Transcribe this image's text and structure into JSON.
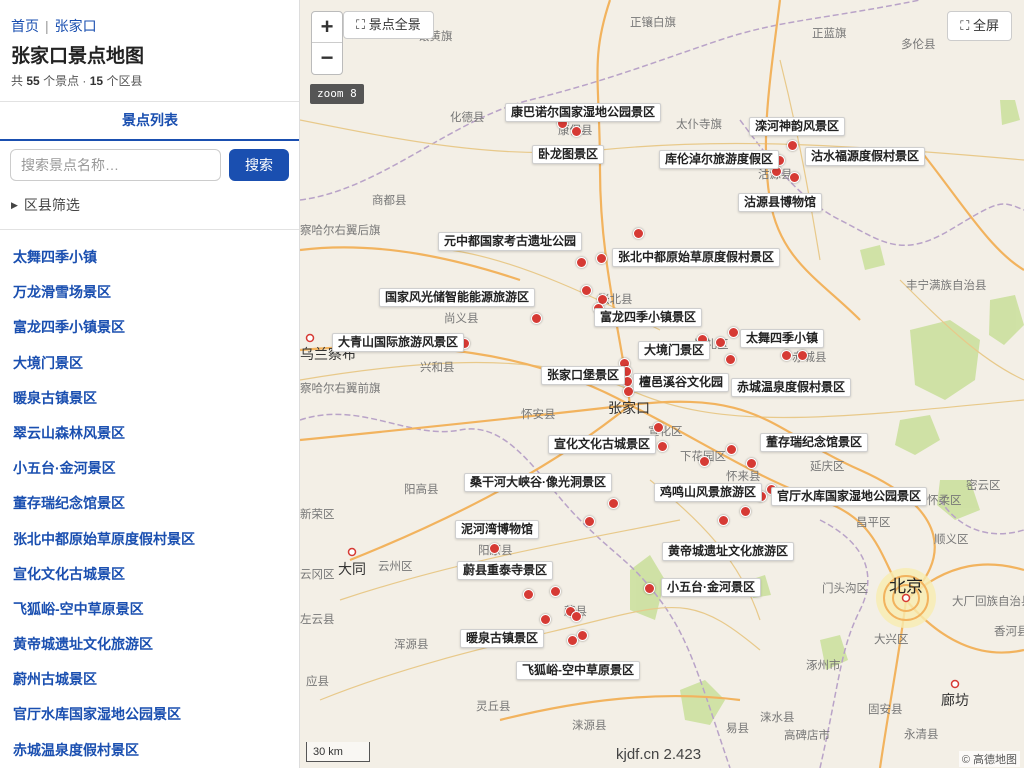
{
  "breadcrumb": {
    "home": "首页",
    "current": "张家口"
  },
  "title": "张家口景点地图",
  "stats": {
    "prefix": "共",
    "spots": "55",
    "spots_suffix": "个景点 ·",
    "counties": "15",
    "counties_suffix": "个区县"
  },
  "tab": "景点列表",
  "search": {
    "placeholder": "搜索景点名称…",
    "button": "搜索"
  },
  "filter": {
    "label": "区县筛选"
  },
  "spots": [
    "太舞四季小镇",
    "万龙滑雪场景区",
    "富龙四季小镇景区",
    "大境门景区",
    "暖泉古镇景区",
    "翠云山森林风景区",
    "小五台·金河景区",
    "董存瑞纪念馆景区",
    "张北中都原始草原度假村景区",
    "宣化文化古城景区",
    "飞狐峪-空中草原景区",
    "黄帝城遗址文化旅游区",
    "蔚州古城景区",
    "官厅水库国家湿地公园景区",
    "赤城温泉度假村景区"
  ],
  "map": {
    "zoom_in": "+",
    "zoom_out": "−",
    "overview": "景点全景",
    "fullscreen": "全屏",
    "zoom_level": "zoom 8",
    "scale": "30 km",
    "brand": "kjdf.cn 2.423",
    "attribution": "© 高德地图",
    "places": [
      {
        "name": "正镶白旗",
        "cls": ""
      },
      {
        "name": "镶黄旗",
        "cls": ""
      },
      {
        "name": "正蓝旗",
        "cls": ""
      },
      {
        "name": "多伦县",
        "cls": ""
      },
      {
        "name": "化德县",
        "cls": ""
      },
      {
        "name": "太仆寺旗",
        "cls": ""
      },
      {
        "name": "康保县",
        "cls": ""
      },
      {
        "name": "沽源县",
        "cls": ""
      },
      {
        "name": "商都县",
        "cls": ""
      },
      {
        "name": "察哈尔右翼后旗",
        "cls": ""
      },
      {
        "name": "张北县",
        "cls": ""
      },
      {
        "name": "丰宁满族自治县",
        "cls": ""
      },
      {
        "name": "尚义县",
        "cls": ""
      },
      {
        "name": "崇礼区",
        "cls": ""
      },
      {
        "name": "赤城县",
        "cls": ""
      },
      {
        "name": "乌兰察布",
        "cls": "city"
      },
      {
        "name": "兴和县",
        "cls": ""
      },
      {
        "name": "察哈尔右翼前旗",
        "cls": ""
      },
      {
        "name": "怀安县",
        "cls": ""
      },
      {
        "name": "张家口",
        "cls": "city"
      },
      {
        "name": "宣化区",
        "cls": ""
      },
      {
        "name": "下花园区",
        "cls": ""
      },
      {
        "name": "延庆区",
        "cls": ""
      },
      {
        "name": "怀来县",
        "cls": ""
      },
      {
        "name": "阳高县",
        "cls": ""
      },
      {
        "name": "新荣区",
        "cls": ""
      },
      {
        "name": "怀柔区",
        "cls": ""
      },
      {
        "name": "密云区",
        "cls": ""
      },
      {
        "name": "阳原县",
        "cls": ""
      },
      {
        "name": "昌平区",
        "cls": ""
      },
      {
        "name": "顺义区",
        "cls": ""
      },
      {
        "name": "大同",
        "cls": "city"
      },
      {
        "name": "云州区",
        "cls": ""
      },
      {
        "name": "云冈区",
        "cls": ""
      },
      {
        "name": "蔚县",
        "cls": ""
      },
      {
        "name": "门头沟区",
        "cls": ""
      },
      {
        "name": "北京",
        "cls": "capital"
      },
      {
        "name": "大厂回族自治县",
        "cls": ""
      },
      {
        "name": "左云县",
        "cls": ""
      },
      {
        "name": "大兴区",
        "cls": ""
      },
      {
        "name": "浑源县",
        "cls": ""
      },
      {
        "name": "香河县",
        "cls": ""
      },
      {
        "name": "应县",
        "cls": ""
      },
      {
        "name": "涿州市",
        "cls": ""
      },
      {
        "name": "廊坊",
        "cls": "city"
      },
      {
        "name": "灵丘县",
        "cls": ""
      },
      {
        "name": "涞源县",
        "cls": ""
      },
      {
        "name": "易县",
        "cls": ""
      },
      {
        "name": "涞水县",
        "cls": ""
      },
      {
        "name": "高碑店市",
        "cls": ""
      },
      {
        "name": "固安县",
        "cls": ""
      },
      {
        "name": "永清县",
        "cls": ""
      }
    ],
    "poi_labels": [
      "康巴诺尔国家湿地公园景区",
      "滦河神韵风景区",
      "卧龙图景区",
      "库伦淖尔旅游度假区",
      "沽水福源度假村景区",
      "沽源县博物馆",
      "元中都国家考古遗址公园",
      "张北中都原始草原度假村景区",
      "国家风光储智能能源旅游区",
      "富龙四季小镇景区",
      "大青山国际旅游风景区",
      "太舞四季小镇",
      "大境门景区",
      "张家口堡景区",
      "檀邑溪谷文化园",
      "赤城温泉度假村景区",
      "宣化文化古城景区",
      "董存瑞纪念馆景区",
      "桑干河大峡谷·像光洞景区",
      "鸡鸣山风景旅游区",
      "官厅水库国家湿地公园景区",
      "泥河湾博物馆",
      "黄帝城遗址文化旅游区",
      "蔚县重泰寺景区",
      "小五台·金河景区",
      "暖泉古镇景区",
      "飞狐峪-空中草原景区"
    ]
  },
  "colors": {
    "accent": "#1a4fb0",
    "marker": "#d63a34",
    "land": "#f3efe6",
    "road_major": "#f2b35e",
    "green": "#c9df9a"
  }
}
